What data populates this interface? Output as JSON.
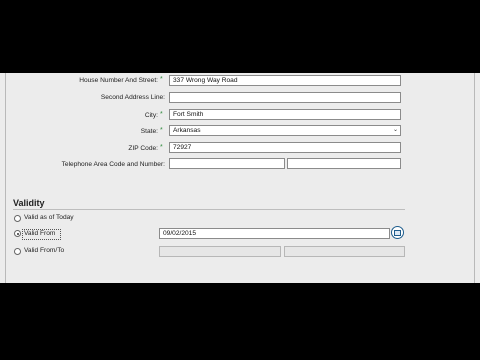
{
  "address": {
    "house_label": "House Number And Street:",
    "house_value": "337 Wrong Way Road",
    "second_label": "Second Address Line:",
    "second_value": "",
    "city_label": "City:",
    "city_value": "Fort Smith",
    "state_label": "State:",
    "state_value": "Arkansas",
    "zip_label": "ZIP Code:",
    "zip_value": "72927",
    "phone_label": "Telephone Area Code and Number:",
    "phone_area": "",
    "phone_number": "",
    "required_mark": "*"
  },
  "validity": {
    "title": "Validity",
    "option_today": "Valid as of Today",
    "option_from": "Valid From",
    "option_from_to": "Valid From/To",
    "from_date": "09/02/2015",
    "selected": "Valid From"
  },
  "colors": {
    "required": "#2f8b3d",
    "panel_bg": "#ececec",
    "border": "#8b8b8b"
  },
  "icons": {
    "state_dropdown": "chevron-down-icon",
    "date_picker": "calendar-icon"
  }
}
